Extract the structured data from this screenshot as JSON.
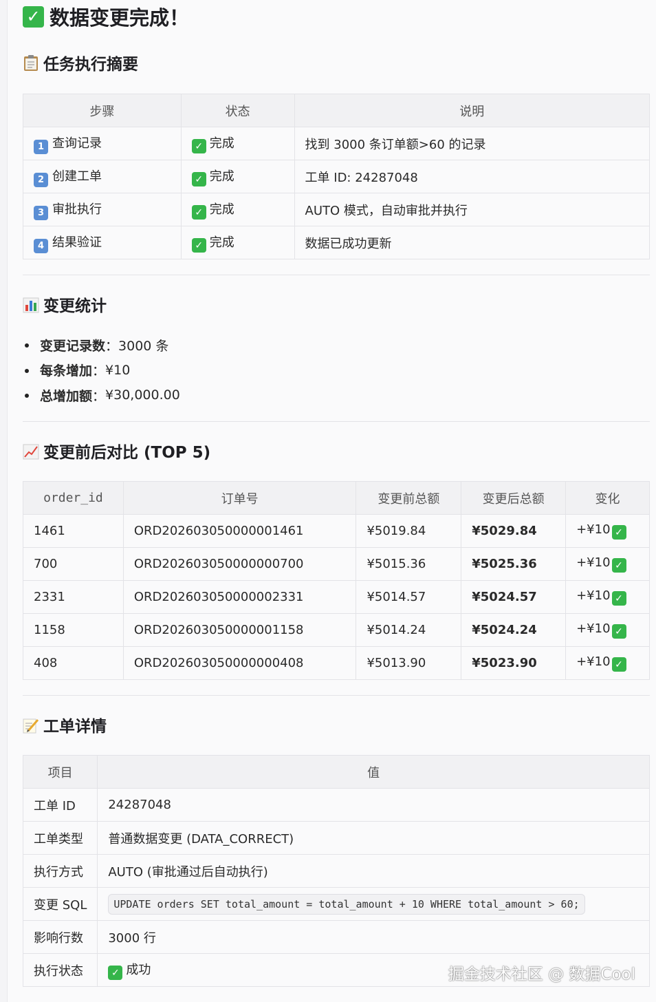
{
  "title": {
    "check": "✓",
    "text": "数据变更完成！"
  },
  "summary": {
    "heading": "任务执行摘要",
    "headers": [
      "步骤",
      "状态",
      "说明"
    ],
    "rows": [
      {
        "num": "1",
        "step": "查询记录",
        "status": "完成",
        "desc": "找到 3000 条订单额>60 的记录"
      },
      {
        "num": "2",
        "step": "创建工单",
        "status": "完成",
        "desc": "工单 ID: 24287048"
      },
      {
        "num": "3",
        "step": "审批执行",
        "status": "完成",
        "desc": "AUTO 模式，自动审批并执行"
      },
      {
        "num": "4",
        "step": "结果验证",
        "status": "完成",
        "desc": "数据已成功更新"
      }
    ]
  },
  "stats": {
    "heading": "变更统计",
    "items": [
      {
        "key": "变更记录数",
        "sep": "：",
        "value": "3000 条"
      },
      {
        "key": "每条增加",
        "sep": "：",
        "value": "¥10"
      },
      {
        "key": "总增加额",
        "sep": "：",
        "value": "¥30,000.00"
      }
    ]
  },
  "compare": {
    "heading": "变更前后对比 (TOP 5)",
    "headers": [
      "order_id",
      "订单号",
      "变更前总额",
      "变更后总额",
      "变化"
    ],
    "rows": [
      {
        "id": "1461",
        "order_no": "ORD202603050000001461",
        "before": "¥5019.84",
        "after": "¥5029.84",
        "change": "+¥10"
      },
      {
        "id": "700",
        "order_no": "ORD202603050000000700",
        "before": "¥5015.36",
        "after": "¥5025.36",
        "change": "+¥10"
      },
      {
        "id": "2331",
        "order_no": "ORD202603050000002331",
        "before": "¥5014.57",
        "after": "¥5024.57",
        "change": "+¥10"
      },
      {
        "id": "1158",
        "order_no": "ORD202603050000001158",
        "before": "¥5014.24",
        "after": "¥5024.24",
        "change": "+¥10"
      },
      {
        "id": "408",
        "order_no": "ORD202603050000000408",
        "before": "¥5013.90",
        "after": "¥5023.90",
        "change": "+¥10"
      }
    ]
  },
  "ticket": {
    "heading": "工单详情",
    "headers": [
      "项目",
      "值"
    ],
    "rows": [
      {
        "item": "工单 ID",
        "value": "24287048"
      },
      {
        "item": "工单类型",
        "value": "普通数据变更 (DATA_CORRECT)"
      },
      {
        "item": "执行方式",
        "value": "AUTO (审批通过后自动执行)"
      },
      {
        "item": "变更 SQL",
        "value": "UPDATE orders SET total_amount = total_amount + 10 WHERE total_amount > 60;"
      },
      {
        "item": "影响行数",
        "value": "3000 行"
      },
      {
        "item": "执行状态",
        "value": "成功"
      }
    ]
  },
  "watermark": "掘金技术社区 @ 数据Cool",
  "colors": {
    "check_green": "#35b54a",
    "keycap_blue": "#5a8ed4"
  }
}
